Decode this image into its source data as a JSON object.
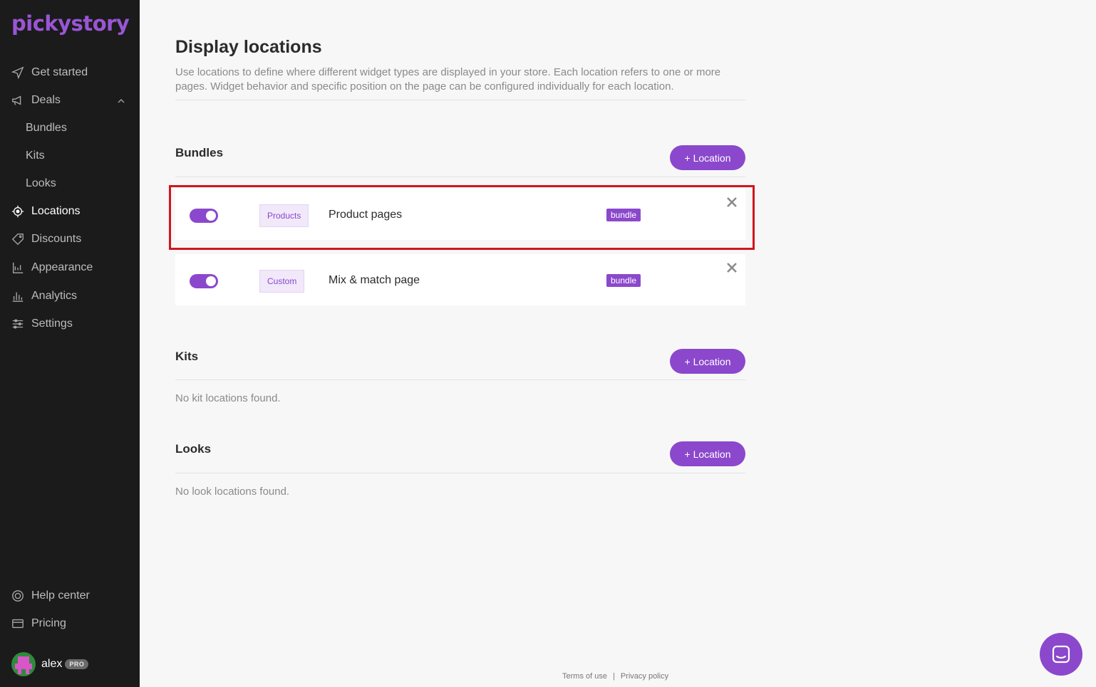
{
  "brand": {
    "logo_text": "pickystory",
    "accent": "#8b48cc"
  },
  "sidebar": {
    "items": [
      {
        "label": "Get started",
        "icon": "send-icon"
      },
      {
        "label": "Deals",
        "icon": "megaphone-icon"
      },
      {
        "label": "Bundles"
      },
      {
        "label": "Kits"
      },
      {
        "label": "Looks"
      },
      {
        "label": "Locations",
        "icon": "target-icon",
        "active": true
      },
      {
        "label": "Discounts",
        "icon": "tag-icon"
      },
      {
        "label": "Appearance",
        "icon": "appearance-icon"
      },
      {
        "label": "Analytics",
        "icon": "analytics-icon"
      },
      {
        "label": "Settings",
        "icon": "sliders-icon"
      }
    ],
    "bottom": [
      {
        "label": "Help center",
        "icon": "help-icon"
      },
      {
        "label": "Pricing",
        "icon": "card-icon"
      }
    ],
    "user": {
      "name": "alex",
      "badge": "PRO"
    }
  },
  "page": {
    "title": "Display locations",
    "description": "Use locations to define where different widget types are displayed in your store. Each location refers to one or more pages. Widget behavior and specific position on the page can be configured individually for each location."
  },
  "sections": {
    "bundles": {
      "title": "Bundles",
      "button": "+ Location",
      "locations": [
        {
          "type": "Products",
          "name": "Product pages",
          "tag": "bundle",
          "enabled": true
        },
        {
          "type": "Custom",
          "name": "Mix & match page",
          "tag": "bundle",
          "enabled": true
        }
      ]
    },
    "kits": {
      "title": "Kits",
      "button": "+ Location",
      "empty": "No kit locations found."
    },
    "looks": {
      "title": "Looks",
      "button": "+ Location",
      "empty": "No look locations found."
    }
  },
  "footer": {
    "terms": "Terms of use",
    "separator": "|",
    "privacy": "Privacy policy"
  }
}
